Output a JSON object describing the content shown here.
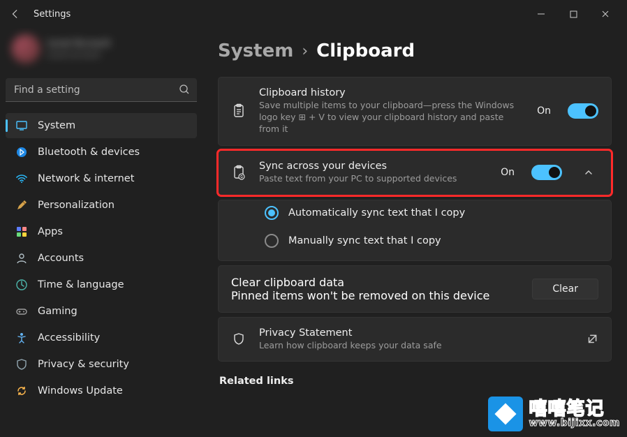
{
  "titlebar": {
    "title": "Settings"
  },
  "profile": {
    "name": "Local Account",
    "email": "Local account"
  },
  "search": {
    "placeholder": "Find a setting"
  },
  "sidebar": {
    "items": [
      {
        "label": "System"
      },
      {
        "label": "Bluetooth & devices"
      },
      {
        "label": "Network & internet"
      },
      {
        "label": "Personalization"
      },
      {
        "label": "Apps"
      },
      {
        "label": "Accounts"
      },
      {
        "label": "Time & language"
      },
      {
        "label": "Gaming"
      },
      {
        "label": "Accessibility"
      },
      {
        "label": "Privacy & security"
      },
      {
        "label": "Windows Update"
      }
    ]
  },
  "breadcrumb": {
    "parent": "System",
    "current": "Clipboard"
  },
  "history": {
    "title": "Clipboard history",
    "desc": "Save multiple items to your clipboard—press the Windows logo key ⊞ + V to view your clipboard history and paste from it",
    "state": "On"
  },
  "sync": {
    "title": "Sync across your devices",
    "desc": "Paste text from your PC to supported devices",
    "state": "On",
    "option_auto": "Automatically sync text that I copy",
    "option_manual": "Manually sync text that I copy"
  },
  "clear": {
    "title": "Clear clipboard data",
    "desc": "Pinned items won't be removed on this device",
    "button": "Clear"
  },
  "privacy": {
    "title": "Privacy Statement",
    "desc": "Learn how clipboard keeps your data safe"
  },
  "related": {
    "heading": "Related links"
  },
  "watermark": {
    "line1": "嘻嘻笔记",
    "line2": "www.bijixx.com"
  }
}
